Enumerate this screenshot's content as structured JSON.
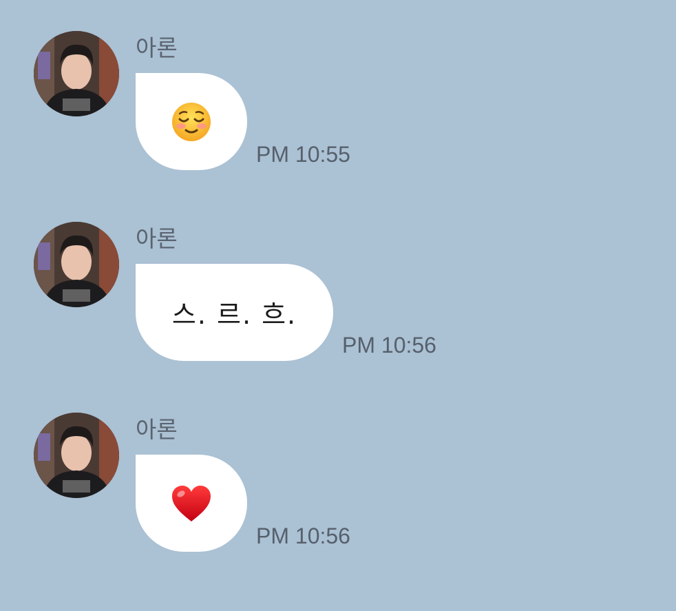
{
  "messages": [
    {
      "sender": "아론",
      "content_type": "emoji",
      "emoji": "smiling-face-icon",
      "time": "PM 10:55"
    },
    {
      "sender": "아론",
      "content_type": "text",
      "text": "스. 르. 흐.",
      "time": "PM 10:56"
    },
    {
      "sender": "아론",
      "content_type": "emoji",
      "emoji": "red-heart-icon",
      "time": "PM 10:56"
    }
  ],
  "colors": {
    "chat_background": "#abc1d4",
    "bubble": "#ffffff",
    "sender_name": "#5a6470",
    "timestamp": "#56606c"
  }
}
